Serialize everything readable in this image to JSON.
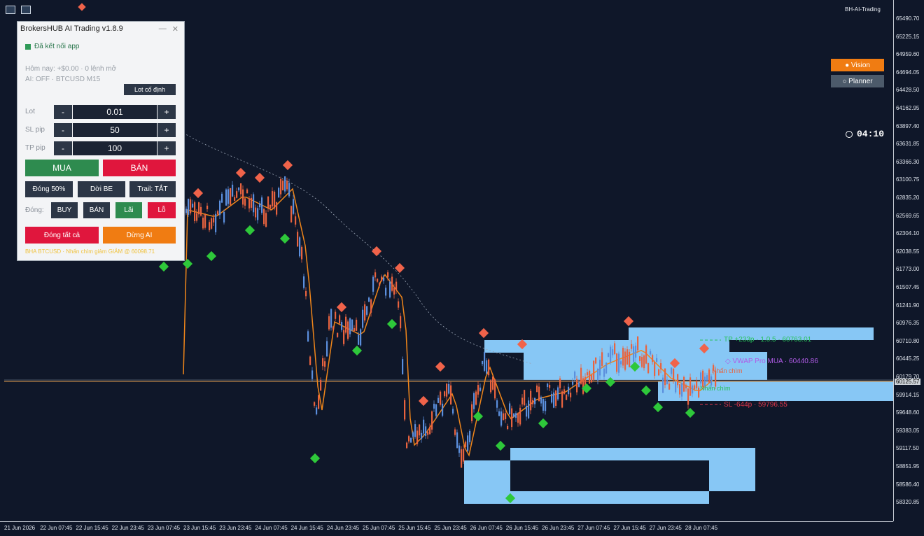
{
  "chart_data": {
    "type": "candlestick",
    "symbol": "BTCUSD",
    "timeframe": "M15",
    "ylim": [
      58200,
      65650
    ],
    "price_ticks": [
      "65490.70",
      "65225.15",
      "64959.60",
      "64694.05",
      "64428.50",
      "64162.95",
      "63897.40",
      "63631.85",
      "63366.30",
      "63100.75",
      "62835.20",
      "62569.65",
      "62304.10",
      "62038.55",
      "61773.00",
      "61507.45",
      "61241.90",
      "60976.35",
      "60710.80",
      "60445.25",
      "60179.70",
      "59914.15",
      "59648.60",
      "59383.05",
      "59117.50",
      "58851.95",
      "58586.40",
      "58320.85"
    ],
    "current_price": "60125.57",
    "time_ticks": [
      "21 Jun 2026",
      "22 Jun 07:45",
      "22 Jun 15:45",
      "22 Jun 23:45",
      "23 Jun 07:45",
      "23 Jun 15:45",
      "23 Jun 23:45",
      "24 Jun 07:45",
      "24 Jun 15:45",
      "24 Jun 23:45",
      "25 Jun 07:45",
      "25 Jun 15:45",
      "25 Jun 23:45",
      "26 Jun 07:45",
      "26 Jun 15:45",
      "26 Jun 23:45",
      "27 Jun 07:45",
      "27 Jun 15:45",
      "27 Jun 23:45",
      "28 Jun 07:45"
    ],
    "annotations": {
      "tp": "TP +233p · 1.0.5 · 60763.01",
      "vwap": "◇ VWAP Pro MUA · 60440.86",
      "sl": "SL -644p · 59796.55",
      "engulf1": "Nhấn chìm",
      "engulf2": "Nhấn chìm"
    },
    "colors": {
      "bull": "#5b8fdd",
      "bear": "#e8633f",
      "ma": "#f0861a",
      "buy_marker": "#2ec83a",
      "sell_marker": "#f0634a",
      "zone": "#87c7f5",
      "tp": "#27c25a",
      "sl": "#e0364a",
      "vwap": "#b05be6"
    }
  },
  "toolbar": {
    "brand": "BH-AI-Trading",
    "vision": "● Vision",
    "planner": "○ Planner",
    "timer": "04:10"
  },
  "panel": {
    "title": "BrokersHUB AI Trading v1.8.9",
    "minimize": "—",
    "close": "✕",
    "status": "Đã kết nối app",
    "today": "Hôm nay: +$0.00 · 0 lệnh mở",
    "ai": "AI: OFF · BTCUSD M15",
    "lot_mode": "Lot cố định",
    "lot": {
      "label": "Lot",
      "value": "0.01"
    },
    "sl": {
      "label": "SL pip",
      "value": "50"
    },
    "tp": {
      "label": "TP pip",
      "value": "100"
    },
    "minus": "-",
    "plus": "+",
    "buy": "MUA",
    "sell": "BÁN",
    "close_half": "Đóng 50%",
    "move_be": "Dời BE",
    "trail": "Trail: TẮT",
    "close_label": "Đóng:",
    "close_buy": "BUY",
    "close_sell": "BÁN",
    "close_profit": "Lãi",
    "close_loss": "Lỗ",
    "close_all": "Đóng tất cả",
    "stop_ai": "Dừng AI",
    "footer": "BHA BTCUSD · Nhấn chìm giảm GIẢM @ 60098.71"
  }
}
